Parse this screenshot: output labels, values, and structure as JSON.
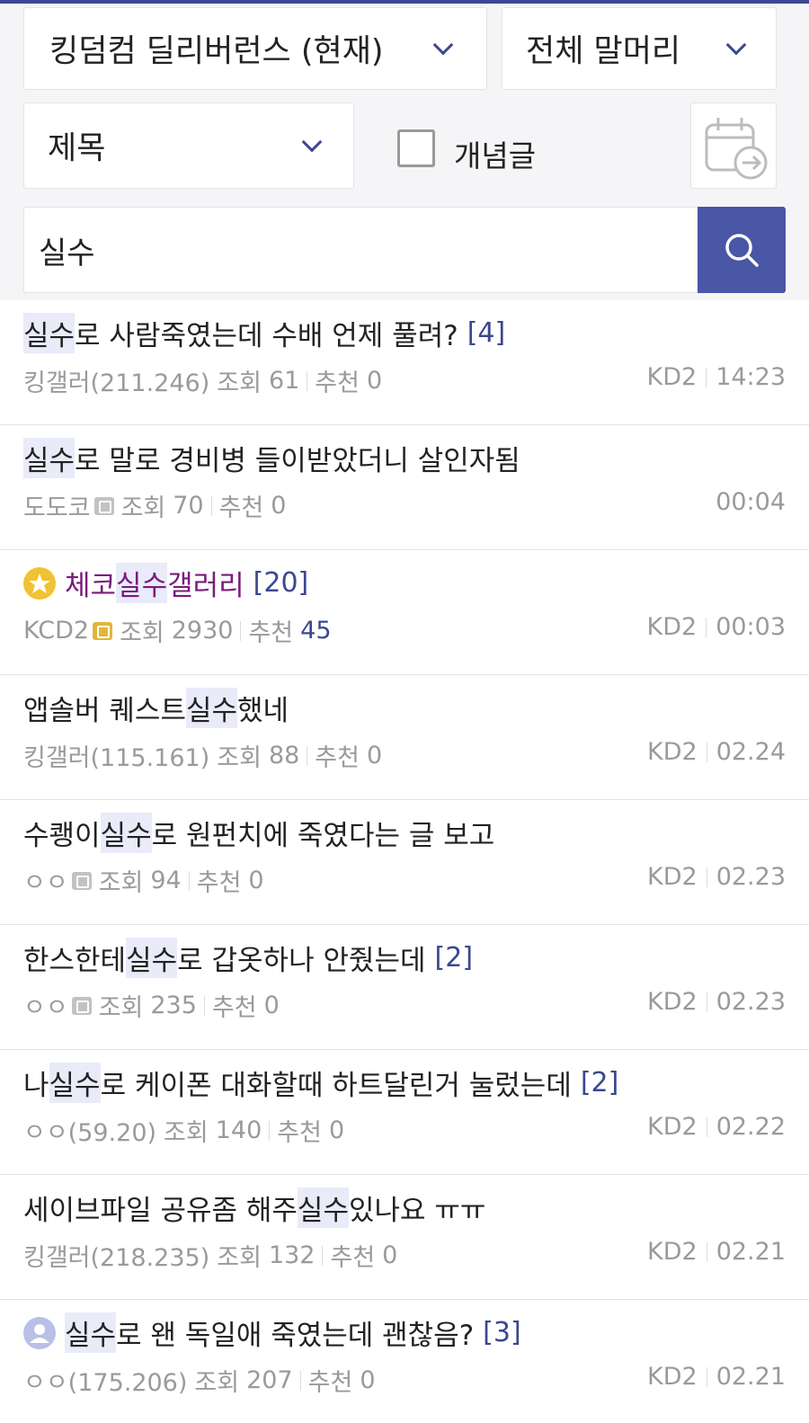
{
  "filters": {
    "gallery_select": "킹덤컴 딜리버런스 (현재)",
    "header_select": "전체 말머리",
    "field_select": "제목",
    "concept_label": "개념글",
    "search_value": "실수"
  },
  "posts": [
    {
      "title_pre": "",
      "title_hl": "실수",
      "title_post": "로 사람죽였는데 수배 언제 풀려?",
      "comments": "[4]",
      "author": "킹갤러(211.246)",
      "views_label": "조회",
      "views": "61",
      "rec_label": "추천",
      "rec": "0",
      "tag": "KD2",
      "time": "14:23"
    },
    {
      "title_pre": "",
      "title_hl": "실수",
      "title_post": "로 말로 경비병 들이받았더니 살인자됨",
      "comments": "",
      "author": "도도코",
      "views_label": "조회",
      "views": "70",
      "rec_label": "추천",
      "rec": "0",
      "tag": "",
      "time": "00:04"
    },
    {
      "title_pre": "체코 ",
      "title_hl": "실수",
      "title_post": " 갤러리",
      "comments": "[20]",
      "author": "KCD2",
      "views_label": "조회",
      "views": "2930",
      "rec_label": "추천",
      "rec": "45",
      "tag": "KD2",
      "time": "00:03"
    },
    {
      "title_pre": "앱솔버 퀘스트 ",
      "title_hl": "실수",
      "title_post": "했네",
      "comments": "",
      "author": "킹갤러(115.161)",
      "views_label": "조회",
      "views": "88",
      "rec_label": "추천",
      "rec": "0",
      "tag": "KD2",
      "time": "02.24"
    },
    {
      "title_pre": "수쾡이 ",
      "title_hl": "실수",
      "title_post": "로 원펀치에 죽였다는 글 보고",
      "comments": "",
      "author": "ㅇㅇ",
      "views_label": "조회",
      "views": "94",
      "rec_label": "추천",
      "rec": "0",
      "tag": "KD2",
      "time": "02.23"
    },
    {
      "title_pre": "한스한테 ",
      "title_hl": "실수",
      "title_post": "로 갑옷하나 안줬는데",
      "comments": "[2]",
      "author": "ㅇㅇ",
      "views_label": "조회",
      "views": "235",
      "rec_label": "추천",
      "rec": "0",
      "tag": "KD2",
      "time": "02.23"
    },
    {
      "title_pre": "나 ",
      "title_hl": "실수",
      "title_post": "로 케이폰 대화할때 하트달린거 눌렀는데",
      "comments": "[2]",
      "author": "ㅇㅇ(59.20)",
      "views_label": "조회",
      "views": "140",
      "rec_label": "추천",
      "rec": "0",
      "tag": "KD2",
      "time": "02.22"
    },
    {
      "title_pre": "세이브파일 공유좀 해주",
      "title_hl": "실수",
      "title_post": "있나요 ㅠㅠ",
      "comments": "",
      "author": "킹갤러(218.235)",
      "views_label": "조회",
      "views": "132",
      "rec_label": "추천",
      "rec": "0",
      "tag": "KD2",
      "time": "02.21"
    },
    {
      "title_pre": "",
      "title_hl": "실수",
      "title_post": "로 왠 독일애 죽였는데 괜찮음?",
      "comments": "[3]",
      "author": "ㅇㅇ(175.206)",
      "views_label": "조회",
      "views": "207",
      "rec_label": "추천",
      "rec": "0",
      "tag": "KD2",
      "time": "02.21"
    }
  ]
}
